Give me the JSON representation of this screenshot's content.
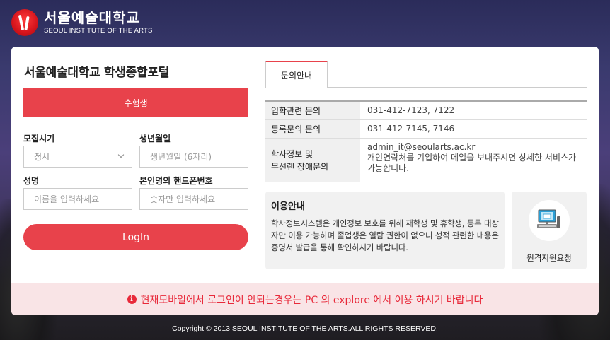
{
  "logo": {
    "name_ko": "서울예술대학교",
    "name_en": "SEOUL INSTITUTE OF THE ARTS"
  },
  "login": {
    "portal_title": "서울예술대학교 학생종합포털",
    "tab_label": "수험생",
    "recruit_label": "모집시기",
    "recruit_value": "정시",
    "birth_label": "생년월일",
    "birth_placeholder": "생년월일 (6자리)",
    "name_label": "성명",
    "name_placeholder": "이름을 입력하세요",
    "phone_label": "본인명의 핸드폰번호",
    "phone_placeholder": "숫자만 입력하세요",
    "login_button": "LogIn"
  },
  "inquiry": {
    "tab_label": "문의안내",
    "rows": [
      {
        "head": "입학관련 문의",
        "value": "031-412-7123, 7122"
      },
      {
        "head": "등록문의 문의",
        "value": "031-412-7145, 7146"
      },
      {
        "head": "학사정보 및\n무선랜 장애문의",
        "value_line1": "admin_it@seoularts.ac.kr",
        "value_line2": "개인연락처를 기입하여 메일을 보내주시면 상세한 서비스가 가능합니다."
      }
    ]
  },
  "usage": {
    "title": "이용안내",
    "text": "학사정보시스템은 개인정보 보호를 위해 재학생 및 휴학생, 등록 대상자만 이용 가능하며 졸업생은 열람 권한이 없으니 성적 관련한 내용은 증명서 발급을 통해 확인하시기 바랍니다."
  },
  "remote": {
    "label": "원격지원요청",
    "icon": "computer-support-icon"
  },
  "notice": {
    "icon": "info-icon",
    "text": "현재모바일에서 로그인이 안되는경우는 PC 의 explore 에서 이용 하시기 바랍니다"
  },
  "footer": {
    "copyright": "Copyright © 2013 SEOUL INSTITUTE OF THE ARTS.ALL RIGHTS RESERVED."
  },
  "colors": {
    "accent": "#e8424b",
    "notice_text": "#e8293a"
  }
}
